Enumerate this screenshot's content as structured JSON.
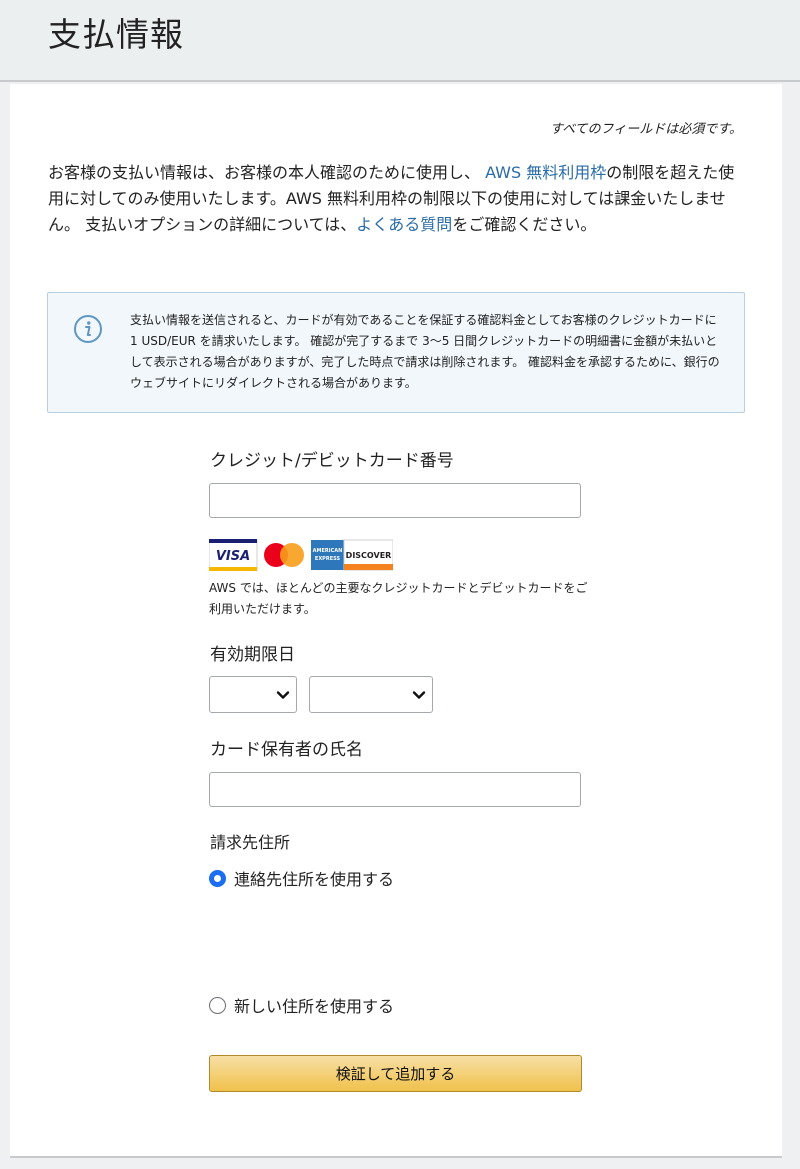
{
  "header": {
    "title": "支払情報"
  },
  "form": {
    "required_note": "すべてのフィールドは必須です。",
    "intro": {
      "part1": "お客様の支払い情報は、お客様の本人確認のために使用し、",
      "link1": "AWS 無料利用枠",
      "part2": "の制限を超えた使用に対してのみ使用いたします。AWS 無料利用枠の制限以下の使用に対しては課金いたしません。 支払いオプションの詳細については、",
      "link2": "よくある質問",
      "part3": "をご確認ください。"
    },
    "info_box": {
      "icon": "info-icon",
      "text": "支払い情報を送信されると、カードが有効であることを保証する確認料金としてお客様のクレジットカードに 1 USD/EUR を請求いたします。 確認が完了するまで 3〜5 日間クレジットカードの明細書に金額が未払いとして表示される場合がありますが、完了した時点で請求は削除されます。 確認料金を承認するために、銀行のウェブサイトにリダイレクトされる場合があります。"
    },
    "card_number": {
      "label": "クレジット/デビットカード番号",
      "value": ""
    },
    "card_brands": {
      "visa": "VISA",
      "amex_line1": "AMERICAN",
      "amex_line2": "EXPRESS",
      "discover": "DISCOVER"
    },
    "cards_note": "AWS では、ほとんどの主要なクレジットカードとデビットカードをご利用いただけます。",
    "expiry": {
      "label": "有効期限日",
      "month": "",
      "year": ""
    },
    "cardholder": {
      "label": "カード保有者の氏名",
      "value": ""
    },
    "billing": {
      "label": "請求先住所",
      "option_contact": "連絡先住所を使用する",
      "option_new": "新しい住所を使用する",
      "selected": "contact"
    },
    "submit_label": "検証して追加する"
  },
  "colors": {
    "link": "#2a6ca7",
    "radio_selected": "#1b6ef0",
    "button": "#f0c14b",
    "info_bg": "#f1f7fb"
  }
}
